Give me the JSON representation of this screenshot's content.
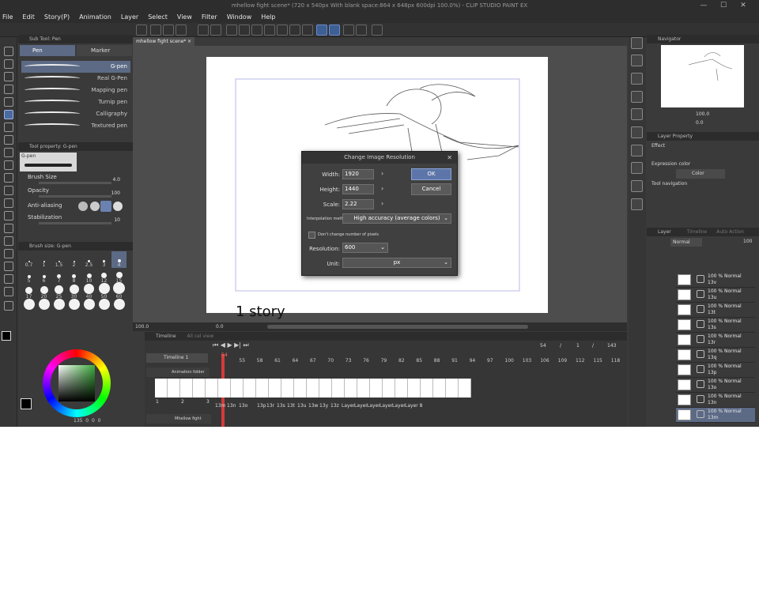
{
  "window": {
    "title": "mhellow fight scene* (720 x 540px With blank space:864 x 648px 600dpi 100.0%) - CLIP STUDIO PAINT EX",
    "minimize": "—",
    "maximize": "☐",
    "close": "✕"
  },
  "menu": [
    "File",
    "Edit",
    "Story(P)",
    "Animation",
    "Layer",
    "Select",
    "View",
    "Filter",
    "Window",
    "Help"
  ],
  "subtool": {
    "header": "Sub Tool: Pen",
    "tabs": [
      "Pen",
      "Marker"
    ],
    "pens": [
      "G-pen",
      "Real G-Pen",
      "Mapping pen",
      "Turnip pen",
      "Calligraphy",
      "Textured pen"
    ],
    "selected": "G-pen"
  },
  "toolprop": {
    "header": "Tool property: G-pen",
    "preview_label": "G-pen",
    "brush_size_label": "Brush Size",
    "brush_size": "4.0",
    "opacity_label": "Opacity",
    "opacity": "100",
    "antialias_label": "Anti-aliasing",
    "stabilization_label": "Stabilization",
    "stabilization": "10"
  },
  "brushsize": {
    "header": "Brush size: G-pen",
    "sizes": [
      "0.7",
      "1",
      "1.5",
      "2",
      "2.5",
      "3",
      "4",
      "5",
      "6",
      "7",
      "8",
      "10",
      "12",
      "15",
      "17",
      "20",
      "25",
      "30",
      "40",
      "50",
      "60",
      "70",
      "80",
      "100",
      "120",
      "150",
      "170",
      "200"
    ]
  },
  "color": {
    "status": "135",
    "r": "0",
    "g": "0",
    "b": "0",
    "main": "#000000",
    "sub": "#ffffff"
  },
  "doc_tab": {
    "label": "mhellow fight scene*",
    "close": "×"
  },
  "canvas": {
    "caption": "1 story"
  },
  "status": {
    "zoom": "100.0",
    "angle": "0.0"
  },
  "dialog": {
    "title": "Change Image Resolution",
    "width_label": "Width:",
    "width": "1920",
    "height_label": "Height:",
    "height": "1440",
    "scale_label": "Scale:",
    "scale": "2.22",
    "interp_label": "Interpolation meth",
    "interp": "High accuracy (average colors)",
    "keep_pixels_label": "Don't change number of pixels",
    "resolution_label": "Resolution:",
    "resolution": "600",
    "unit_label": "Unit:",
    "unit": "px",
    "ok": "OK",
    "cancel": "Cancel"
  },
  "timeline": {
    "header": "Timeline",
    "tab2": "All cel view",
    "name": "Timeline 1",
    "current": "54",
    "slash": "/",
    "one": "1",
    "total": "143",
    "ruler": [
      "54",
      "55",
      "58",
      "61",
      "64",
      "67",
      "70",
      "73",
      "76",
      "79",
      "82",
      "85",
      "88",
      "91",
      "94",
      "97",
      "100",
      "103",
      "106",
      "109",
      "112",
      "115",
      "118",
      "121"
    ],
    "marks": [
      "1",
      "2",
      "3",
      "4"
    ],
    "folder": "Animation folder",
    "track2": "Mhellow fight scene",
    "frame_nums": [
      "1",
      "2",
      "3"
    ],
    "cels": [
      "13m",
      "13n",
      "13o",
      "13p",
      "13r",
      "13s",
      "13t",
      "13u",
      "13w",
      "13y",
      "13z",
      "Layer",
      "Layer",
      "Layer",
      "Layer",
      "Layer",
      "Layer 8"
    ]
  },
  "navigator": {
    "header": "Navigator",
    "zoom": "100.0",
    "angle": "0.0"
  },
  "layerprop": {
    "header": "Layer Property",
    "effect": "Effect",
    "expr_label": "Expression color",
    "expr": "Color",
    "toolnav": "Tool navigation"
  },
  "layers": {
    "header": "Layer",
    "tab2": "Timeline",
    "tab3": "Auto Action",
    "blend": "Normal",
    "opacity": "100",
    "rows": [
      {
        "pct": "100 % Normal",
        "name": "13v"
      },
      {
        "pct": "100 % Normal",
        "name": "13u"
      },
      {
        "pct": "100 % Normal",
        "name": "13t"
      },
      {
        "pct": "100 % Normal",
        "name": "13s"
      },
      {
        "pct": "100 % Normal",
        "name": "13r"
      },
      {
        "pct": "100 % Normal",
        "name": "13q"
      },
      {
        "pct": "100 % Normal",
        "name": "13p"
      },
      {
        "pct": "100 % Normal",
        "name": "13o"
      },
      {
        "pct": "100 % Normal",
        "name": "13n"
      },
      {
        "pct": "100 % Normal",
        "name": "13m"
      }
    ]
  }
}
